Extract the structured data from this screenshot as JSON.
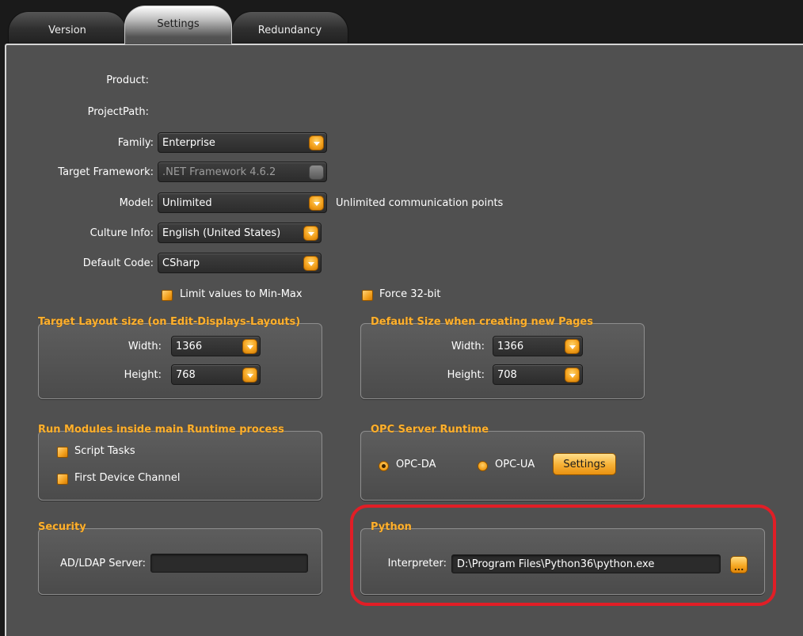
{
  "tabs": [
    {
      "label": "Version"
    },
    {
      "label": "Settings"
    },
    {
      "label": "Redundancy"
    }
  ],
  "settings": {
    "product_label": "Product:",
    "project_path_label": "ProjectPath:",
    "family": {
      "label": "Family:",
      "value": "Enterprise"
    },
    "target_framework": {
      "label": "Target Framework:",
      "value": ".NET Framework 4.6.2"
    },
    "model": {
      "label": "Model:",
      "value": "Unlimited",
      "note": "Unlimited communication points"
    },
    "culture_info": {
      "label": "Culture Info:",
      "value": "English (United States)"
    },
    "default_code": {
      "label": "Default Code:",
      "value": "CSharp"
    },
    "limit_values_label": "Limit values to Min-Max",
    "force_32bit_label": "Force 32-bit"
  },
  "target_layout": {
    "title": "Target Layout size (on Edit-Displays-Layouts)",
    "width_label": "Width:",
    "width_value": "1366",
    "height_label": "Height:",
    "height_value": "768"
  },
  "default_size": {
    "title": "Default Size when creating new Pages",
    "width_label": "Width:",
    "width_value": "1366",
    "height_label": "Height:",
    "height_value": "708"
  },
  "run_modules": {
    "title": "Run Modules inside main Runtime process",
    "script_tasks_label": "Script Tasks",
    "first_device_channel_label": "First Device Channel"
  },
  "opc_server": {
    "title": "OPC Server Runtime",
    "opc_da_label": "OPC-DA",
    "opc_ua_label": "OPC-UA",
    "settings_button_label": "Settings"
  },
  "security": {
    "title": "Security",
    "ad_ldap_label": "AD/LDAP Server:",
    "ad_ldap_value": ""
  },
  "python": {
    "title": "Python",
    "interpreter_label": "Interpreter:",
    "interpreter_value": "D:\\Program Files\\Python36\\python.exe",
    "browse_label": "..."
  },
  "colors": {
    "accent": "#f4a21d",
    "group_title": "#ffb02e",
    "highlight": "#e11e26",
    "panel_bg": "#505050"
  }
}
